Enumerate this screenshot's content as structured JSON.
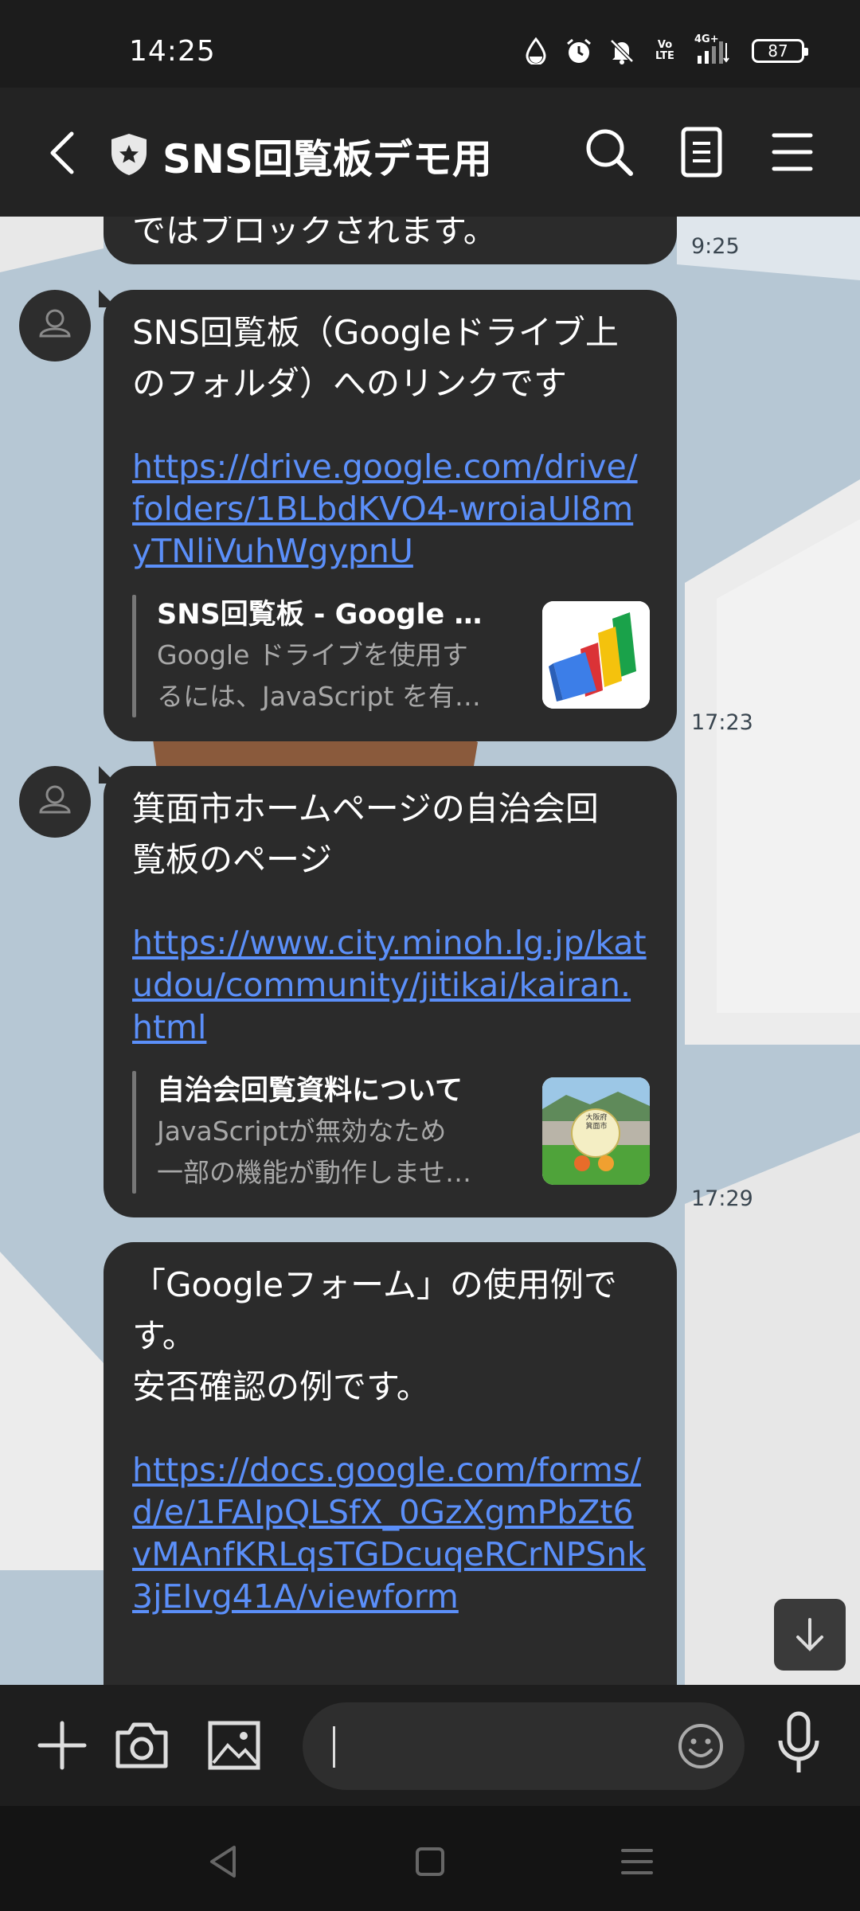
{
  "status_bar": {
    "time": "14:25",
    "volte_label": "Vo\nLTE",
    "network_label": "4G+",
    "battery": "87",
    "icons": [
      "water-drop-icon",
      "alarm-icon",
      "mute-icon",
      "volte-icon",
      "signal-icon",
      "battery-icon"
    ]
  },
  "header": {
    "title": "SNS回覧板デモ用",
    "icons": [
      "back-arrow-icon",
      "shield-icon",
      "search-icon",
      "notes-icon",
      "menu-icon"
    ]
  },
  "messages": [
    {
      "text": "ではブロックされます。",
      "time": "9:25"
    },
    {
      "text": "SNS回覧板（Googleドライブ上\nのフォルダ）へのリンクです",
      "link": "https://drive.google.com/drive/folders/1BLbdKVO4-wroiaUl8myTNliVuhWgypnU",
      "preview_title": "SNS回覧板 - Google ド…",
      "preview_desc": "Google ドライブを使用す\nるには、JavaScript を有…",
      "time": "17:23"
    },
    {
      "text": "箕面市ホームページの自治会回\n覧板のページ",
      "link": "https://www.city.minoh.lg.jp/katudou/community/jitikai/kairan.html",
      "preview_title": "自治会回覧資料について",
      "preview_desc": "JavaScriptが無効なため\n一部の機能が動作しませ…",
      "time": "17:29"
    },
    {
      "text": "「Googleフォーム」の使用例で\nす。\n安否確認の例です。",
      "link": "https://docs.google.com/forms/d/e/1FAIpQLSfX_0GzXgmPbZt6vMAnfKRLqsTGDcuqeRCrNPSnk3jEIvg41A/viewform"
    }
  ],
  "thumb_city_label": "大阪府\n箕面市",
  "input_bar": {
    "placeholder": "",
    "icons": [
      "plus-icon",
      "camera-icon",
      "image-icon",
      "emoji-icon",
      "microphone-icon"
    ]
  },
  "nav_bar": {
    "icons": [
      "nav-back-icon",
      "nav-home-icon",
      "nav-recents-icon"
    ]
  },
  "colors": {
    "link": "#5b8ff9",
    "bubble": "#2b2b2b",
    "header": "#232323",
    "chat_bg": "#b6c7d4"
  }
}
